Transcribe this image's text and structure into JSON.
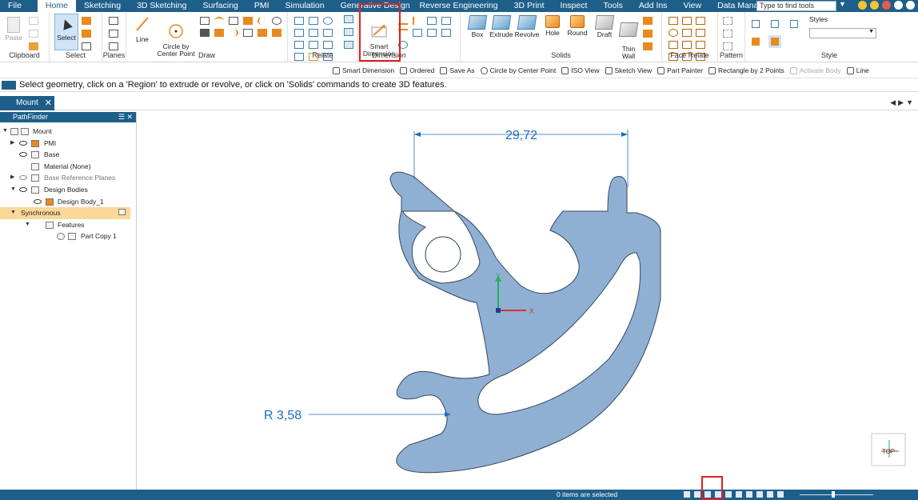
{
  "menu": {
    "tabs": [
      "File",
      "Home",
      "Sketching",
      "3D Sketching",
      "Surfacing",
      "PMI",
      "Simulation",
      "Generative Design",
      "Reverse Engineering",
      "3D Print",
      "Inspect",
      "Tools",
      "Add Ins",
      "View",
      "Data Management"
    ],
    "active_tab": "Home",
    "search_placeholder": "Type to find tools"
  },
  "ribbon": {
    "groups": {
      "clipboard": "Clipboard",
      "select": "Select",
      "planes": "Planes",
      "draw": "Draw",
      "relate": "Relate",
      "dimension": "Dimension",
      "solids": "Solids",
      "face_relate": "Face Relate",
      "pattern": "Pattern",
      "style": "Style"
    },
    "buttons": {
      "paste": "Paste",
      "select": "Select",
      "line": "Line",
      "circle_center": "Circle by\nCenter Point",
      "smart_dimension": "Smart\nDimension",
      "box": "Box",
      "extrude": "Extrude",
      "revolve": "Revolve",
      "hole": "Hole",
      "round": "Round",
      "draft": "Draft",
      "thin_wall": "Thin\nWall",
      "styles": "Styles"
    }
  },
  "command_bar": [
    {
      "label": "Smart Dimension",
      "enabled": true
    },
    {
      "label": "Ordered",
      "enabled": true
    },
    {
      "label": "Save As",
      "enabled": true
    },
    {
      "label": "Circle by Center Point",
      "enabled": true
    },
    {
      "label": "ISO View",
      "enabled": true
    },
    {
      "label": "Sketch View",
      "enabled": true
    },
    {
      "label": "Part Painter",
      "enabled": true
    },
    {
      "label": "Rectangle by 2 Points",
      "enabled": true
    },
    {
      "label": "Activate Body",
      "enabled": false
    },
    {
      "label": "Line",
      "enabled": true
    }
  ],
  "prompt": "Select geometry, click on a 'Region' to extrude or revolve, or click on 'Solids' commands to create 3D features.",
  "document_tab": "Mount",
  "pathfinder": {
    "title": "PathFinder",
    "items": [
      {
        "label": "Mount"
      },
      {
        "label": "PMI"
      },
      {
        "label": "Base"
      },
      {
        "label": "Material (None)"
      },
      {
        "label": "Base Reference Planes"
      },
      {
        "label": "Design Bodies"
      },
      {
        "label": "Design Body_1"
      },
      {
        "label": "Synchronous"
      },
      {
        "label": "Features"
      },
      {
        "label": "Part Copy 1"
      }
    ]
  },
  "canvas": {
    "dimension_linear": "29,72",
    "dimension_radius": "R 3,58",
    "axis_y": "Y",
    "axis_x": "X",
    "view_cube_label": "TOP"
  },
  "status": {
    "selection": "0 items are selected"
  },
  "colors": {
    "accent": "#1e5f8a",
    "part_fill": "#8fb0d3",
    "dimension": "#1a6fc0",
    "highlight_box": "#e02020"
  }
}
